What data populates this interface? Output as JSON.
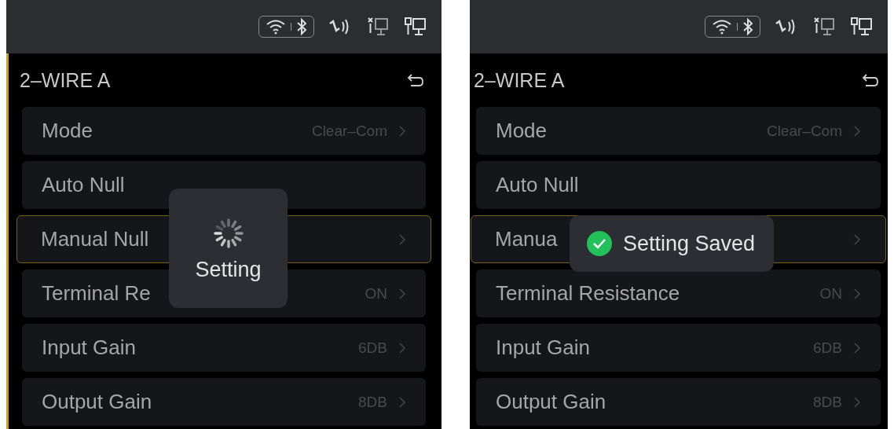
{
  "screens": [
    {
      "title": "2–WIRE A",
      "accent": true,
      "rows": [
        {
          "label": "Mode",
          "value": "Clear–Com",
          "arrow": true,
          "selected": false
        },
        {
          "label": "Auto Null",
          "arrow": false,
          "selected": false
        },
        {
          "label": "Manual Null",
          "arrow": true,
          "selected": true
        },
        {
          "label": "Terminal Re",
          "value": "ON",
          "arrow": true,
          "selected": false
        },
        {
          "label": "Input Gain",
          "value": "6DB",
          "arrow": true,
          "selected": false
        },
        {
          "label": "Output Gain",
          "value": "8DB",
          "arrow": true,
          "selected": false
        }
      ],
      "toast": {
        "kind": "loading",
        "text": "Setting"
      }
    },
    {
      "title": "2–WIRE A",
      "accent": false,
      "rows": [
        {
          "label": "Mode",
          "value": "Clear–Com",
          "arrow": true,
          "selected": false
        },
        {
          "label": "Auto Null",
          "arrow": false,
          "selected": false
        },
        {
          "label": "Manua",
          "arrow": true,
          "selected": true
        },
        {
          "label": "Terminal Resistance",
          "value": "ON",
          "arrow": true,
          "selected": false
        },
        {
          "label": "Input Gain",
          "value": "6DB",
          "arrow": true,
          "selected": false
        },
        {
          "label": "Output Gain",
          "value": "8DB",
          "arrow": true,
          "selected": false
        }
      ],
      "toast": {
        "kind": "success",
        "text": "Setting Saved"
      }
    }
  ]
}
